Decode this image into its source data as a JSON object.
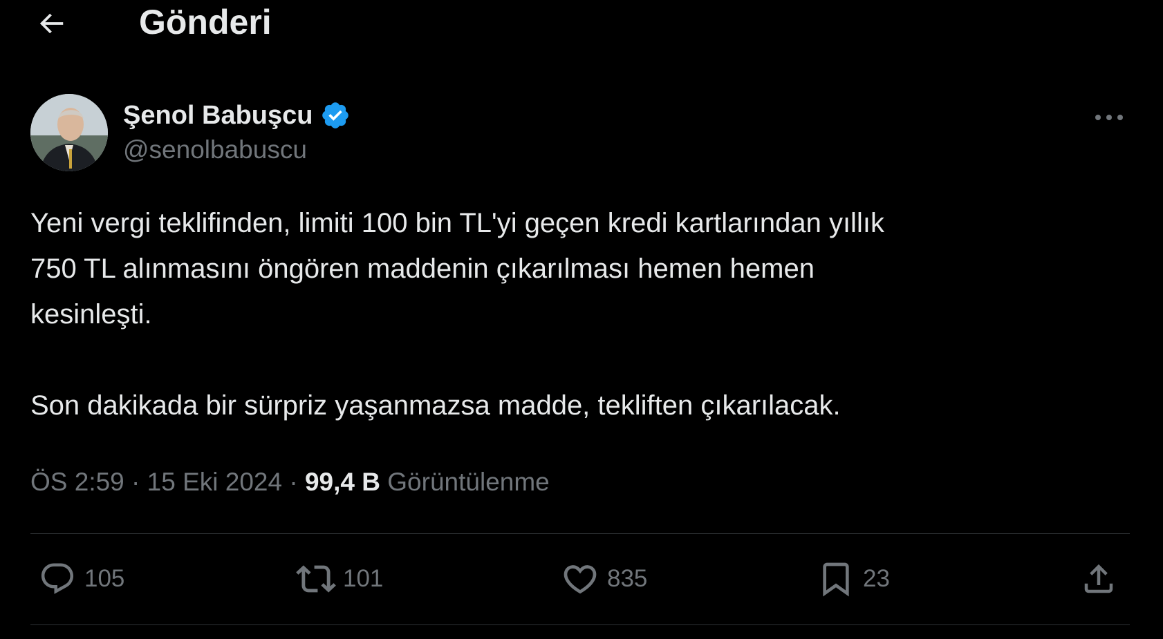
{
  "header": {
    "title": "Gönderi",
    "back_icon": "arrow-left-icon"
  },
  "tweet": {
    "author": {
      "name": "Şenol Babuşcu",
      "handle": "@senolbabuscu",
      "verified": true,
      "verified_color": "#1d9bf0"
    },
    "text": "Yeni vergi teklifinden, limiti 100 bin TL'yi geçen kredi kartlarından yıllık\n750 TL alınmasını öngören maddenin çıkarılması hemen hemen\nkesinleşti.\n\nSon dakikada bir sürpriz yaşanmazsa madde, tekliften çıkarılacak.",
    "time": "ÖS 2:59",
    "separator": " · ",
    "date": "15 Eki 2024",
    "views_count": "99,4 B",
    "views_label": "Görüntülenme",
    "more_icon": "more-horizontal-icon"
  },
  "actions": {
    "reply": {
      "icon": "reply-icon",
      "count": "105"
    },
    "retweet": {
      "icon": "retweet-icon",
      "count": "101"
    },
    "like": {
      "icon": "heart-icon",
      "count": "835"
    },
    "bookmark": {
      "icon": "bookmark-icon",
      "count": "23"
    },
    "share": {
      "icon": "share-icon"
    }
  },
  "colors": {
    "background": "#000000",
    "text_primary": "#e7e9ea",
    "text_secondary": "#71767b",
    "divider": "#2f3336",
    "accent": "#1d9bf0"
  }
}
